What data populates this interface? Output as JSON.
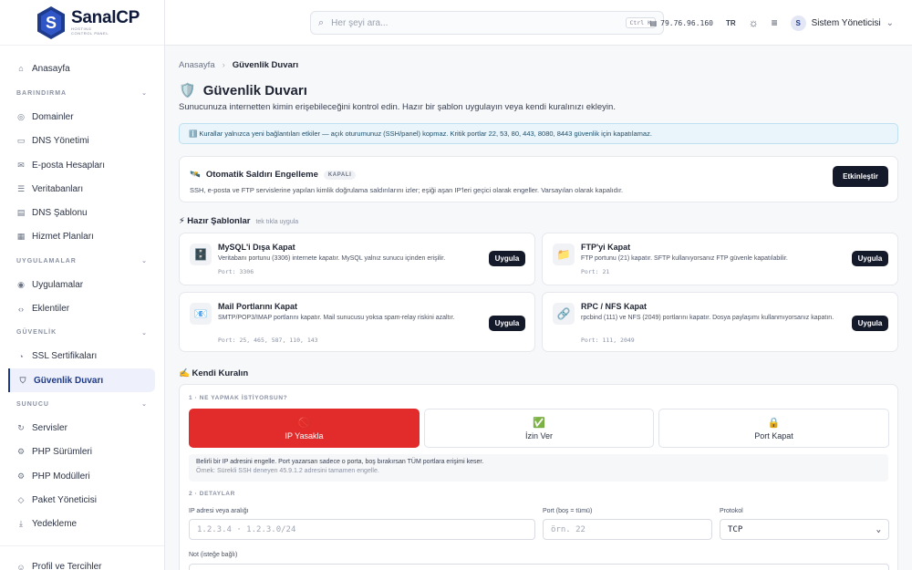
{
  "brand": {
    "name": "SanalCP",
    "sub1": "HOSTING",
    "sub2": "CONTROL PANEL"
  },
  "sidebar": {
    "home": "Anasayfa",
    "sections": [
      {
        "title": "BARINDIRMA",
        "items": [
          "Domainler",
          "DNS Yönetimi",
          "E-posta Hesapları",
          "Veritabanları",
          "DNS Şablonu",
          "Hizmet Planları"
        ]
      },
      {
        "title": "UYGULAMALAR",
        "items": [
          "Uygulamalar",
          "Eklentiler"
        ]
      },
      {
        "title": "GÜVENLİK",
        "items": [
          "SSL Sertifikaları",
          "Güvenlik Duvarı"
        ]
      },
      {
        "title": "SUNUCU",
        "items": [
          "Servisler",
          "PHP Sürümleri",
          "PHP Modülleri",
          "Paket Yöneticisi",
          "Yedekleme"
        ]
      }
    ],
    "profile": "Profil ve Tercihler"
  },
  "topbar": {
    "search_placeholder": "Her şeyi ara...",
    "shortcut": "Ctrl K",
    "ip": "79.76.96.160",
    "lang": "TR",
    "user": "Sistem Yöneticisi",
    "user_initial": "S"
  },
  "page": {
    "breadcrumb": [
      "Anasayfa",
      "Güvenlik Duvarı"
    ],
    "title": "Güvenlik Duvarı",
    "subtitle": "Sunucunuza internetten kimin erişebileceğini kontrol edin. Hazır bir şablon uygulayın veya kendi kuralınızı ekleyin.",
    "info": "ℹ️ Kurallar yalnızca yeni bağlantıları etkiler — açık oturumunuz (SSH/panel) kopmaz. Kritik portlar 22, 53, 80, 443, 8080, 8443 güvenlik için kapatılamaz."
  },
  "auto_block": {
    "title": "Otomatik Saldırı Engelleme",
    "badge": "KAPALI",
    "desc": "SSH, e-posta ve FTP servislerine yapılan kimlik doğrulama saldırılarını izler; eşiği aşan IP'leri geçici olarak engeller. Varsayılan olarak kapalıdır.",
    "button": "Etkinleştir"
  },
  "templates": {
    "heading": "⚡ Hazır Şablonlar",
    "hint": "tek tıkla uygula",
    "apply": "Uygula",
    "items": [
      {
        "icon": "🗄️",
        "title": "MySQL'i Dışa Kapat",
        "desc": "Veritabanı portunu (3306) internete kapatır. MySQL yalnız sunucu içinden erişilir.",
        "port": "Port: 3306"
      },
      {
        "icon": "📁",
        "title": "FTP'yi Kapat",
        "desc": "FTP portunu (21) kapatır. SFTP kullanıyorsanız FTP güvenle kapatılabilir.",
        "port": "Port: 21"
      },
      {
        "icon": "📧",
        "title": "Mail Portlarını Kapat",
        "desc": "SMTP/POP3/IMAP portlarını kapatır. Mail sunucusu yoksa spam-relay riskini azaltır.",
        "port": "Port: 25, 465, 587, 110, 143"
      },
      {
        "icon": "🔗",
        "title": "RPC / NFS Kapat",
        "desc": "rpcbind (111) ve NFS (2049) portlarını kapatır. Dosya paylaşımı kullanmıyorsanız kapatın.",
        "port": "Port: 111, 2049"
      }
    ]
  },
  "own_rule": {
    "heading": "✍️ Kendi Kuralın",
    "step1": "1 · NE YAPMAK İSTİYORSUN?",
    "actions": [
      {
        "icon": "🚫",
        "label": "IP Yasakla"
      },
      {
        "icon": "✅",
        "label": "İzin Ver"
      },
      {
        "icon": "🔒",
        "label": "Port Kapat"
      }
    ],
    "hint": "Belirli bir IP adresini engelle. Port yazarsan sadece o porta, boş bırakırsan TÜM portlara erişimi keser.",
    "example": "Örnek: Sürekli SSH deneyen 45.9.1.2 adresini tamamen engelle.",
    "step2": "2 · DETAYLAR",
    "ip_label": "IP adresi veya aralığı",
    "ip_placeholder": "1.2.3.4  ·  1.2.3.0/24",
    "port_label": "Port (boş = tümü)",
    "port_placeholder": "örn. 22",
    "protocol_label": "Protokol",
    "protocol_value": "TCP",
    "note_label": "Not (isteğe bağlı)"
  },
  "colors": {
    "accent": "#151a2b",
    "danger": "#e22b2b",
    "info_bg": "#eaf5fb"
  }
}
